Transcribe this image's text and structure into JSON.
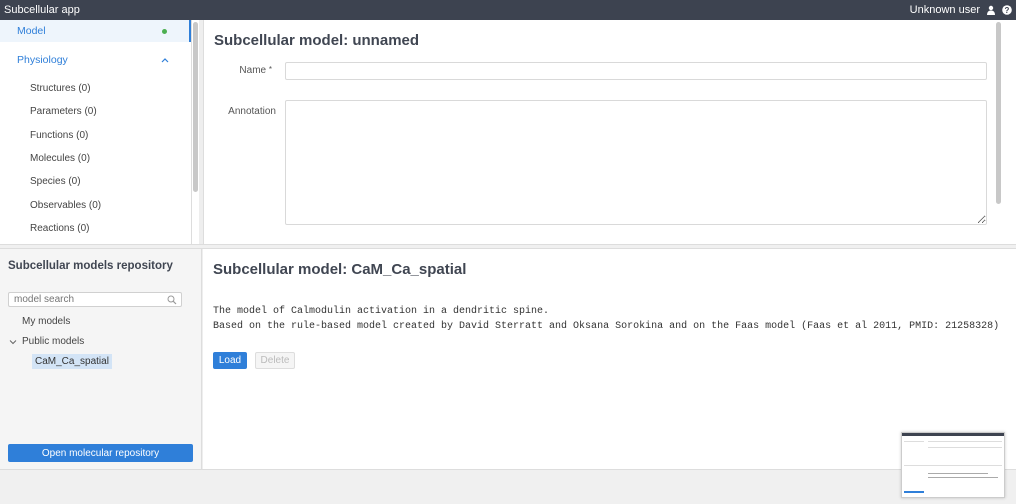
{
  "topbar": {
    "app_title": "Subcellular app",
    "user": "Unknown user",
    "user_icon": "user-icon",
    "help_icon": "help-icon"
  },
  "sidebar": {
    "items": [
      {
        "label": "Model",
        "status": "green-dot"
      },
      {
        "label": "Physiology",
        "icon": "chevron-up-icon"
      }
    ],
    "subitems": [
      {
        "label": "Structures (0)"
      },
      {
        "label": "Parameters (0)"
      },
      {
        "label": "Functions (0)"
      },
      {
        "label": "Molecules (0)"
      },
      {
        "label": "Species (0)"
      },
      {
        "label": "Observables (0)"
      },
      {
        "label": "Reactions (0)"
      }
    ]
  },
  "editor": {
    "title": "Subcellular model: unnamed",
    "name_label": "Name",
    "name_required_mark": "*",
    "name_value": "",
    "annotation_label": "Annotation",
    "annotation_value": ""
  },
  "repository": {
    "title": "Subcellular models repository",
    "search_placeholder": "model search",
    "my_models": "My models",
    "public_models": "Public models",
    "selected_model": "CaM_Ca_spatial",
    "open_button": "Open molecular repository"
  },
  "preview": {
    "title": "Subcellular model: CaM_Ca_spatial",
    "description_line1": "The model of Calmodulin activation in a dendritic spine.",
    "description_line2": "Based on the rule-based model created by David Sterratt and Oksana Sorokina and on the Faas model (Faas et al 2011, PMID: 21258328)",
    "load_button": "Load",
    "delete_button": "Delete"
  },
  "colors": {
    "accent": "#2f7fd9",
    "topbar": "#3d4350",
    "status_ok": "#4caf50"
  }
}
